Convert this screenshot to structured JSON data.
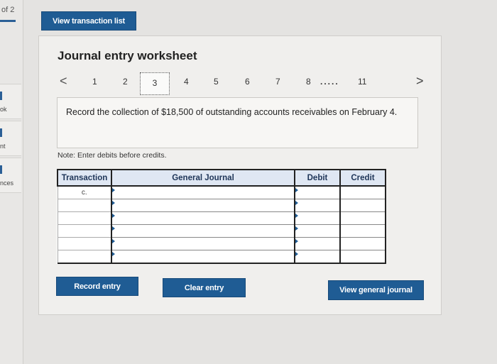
{
  "sidebar": {
    "page_indicator": "of 2",
    "items": [
      {
        "label": "ok"
      },
      {
        "label": "nt"
      },
      {
        "label": "nces"
      }
    ]
  },
  "header": {
    "view_transaction_list": "View transaction list"
  },
  "worksheet": {
    "title": "Journal entry worksheet",
    "pager": {
      "prev": "<",
      "pages": [
        "1",
        "2",
        "3",
        "4",
        "5",
        "6",
        "7",
        "8"
      ],
      "current": "3",
      "ellipsis": ".....",
      "last": "11",
      "next": ">"
    },
    "question": "Record the collection of $18,500 of outstanding accounts receivables on February 4.",
    "note": "Note: Enter debits before credits.",
    "table": {
      "columns": [
        "Transaction",
        "General Journal",
        "Debit",
        "Credit"
      ],
      "rows": [
        {
          "transaction": "c.",
          "account": "",
          "debit": "",
          "credit": ""
        },
        {
          "transaction": "",
          "account": "",
          "debit": "",
          "credit": ""
        },
        {
          "transaction": "",
          "account": "",
          "debit": "",
          "credit": ""
        },
        {
          "transaction": "",
          "account": "",
          "debit": "",
          "credit": ""
        },
        {
          "transaction": "",
          "account": "",
          "debit": "",
          "credit": ""
        },
        {
          "transaction": "",
          "account": "",
          "debit": "",
          "credit": ""
        }
      ]
    },
    "buttons": {
      "record": "Record entry",
      "clear": "Clear entry",
      "view_general": "View general journal"
    }
  },
  "colors": {
    "primary_blue": "#1f5c94",
    "header_bg": "#dfe7f3"
  }
}
